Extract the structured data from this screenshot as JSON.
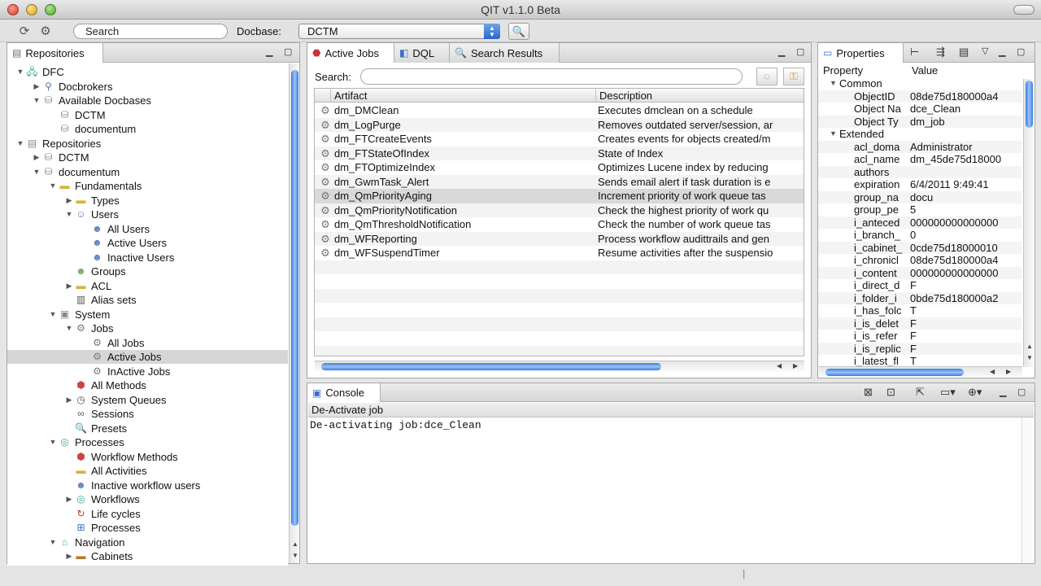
{
  "window": {
    "title": "QIT v1.1.0 Beta"
  },
  "toolbar": {
    "search_label": "Search",
    "docbase_label": "Docbase:",
    "docbase_value": "DCTM"
  },
  "repositories": {
    "tab_label": "Repositories",
    "tree": [
      {
        "label": "DFC",
        "level": 0,
        "expanded": true,
        "icon": "network-icon"
      },
      {
        "label": "Docbrokers",
        "level": 1,
        "expanded": false,
        "icon": "plug-icon"
      },
      {
        "label": "Available Docbases",
        "level": 1,
        "expanded": true,
        "icon": "database-icon"
      },
      {
        "label": "DCTM",
        "level": 2,
        "icon": "database-icon"
      },
      {
        "label": "documentum",
        "level": 2,
        "icon": "database-icon"
      },
      {
        "label": "Repositories",
        "level": 0,
        "expanded": true,
        "icon": "repositories-icon"
      },
      {
        "label": "DCTM",
        "level": 1,
        "expanded": false,
        "icon": "database-icon"
      },
      {
        "label": "documentum",
        "level": 1,
        "expanded": true,
        "icon": "database-icon"
      },
      {
        "label": "Fundamentals",
        "level": 2,
        "expanded": true,
        "icon": "folder-icon"
      },
      {
        "label": "Types",
        "level": 3,
        "expanded": false,
        "icon": "folder-icon"
      },
      {
        "label": "Users",
        "level": 3,
        "expanded": true,
        "icon": "user-icon"
      },
      {
        "label": "All Users",
        "level": 4,
        "icon": "users-icon"
      },
      {
        "label": "Active Users",
        "level": 4,
        "icon": "users-icon"
      },
      {
        "label": "Inactive Users",
        "level": 4,
        "icon": "users-icon"
      },
      {
        "label": "Groups",
        "level": 3,
        "icon": "group-icon"
      },
      {
        "label": "ACL",
        "level": 3,
        "expanded": false,
        "icon": "folder-icon"
      },
      {
        "label": "Alias sets",
        "level": 3,
        "icon": "alias-icon"
      },
      {
        "label": "System",
        "level": 2,
        "expanded": true,
        "icon": "system-icon"
      },
      {
        "label": "Jobs",
        "level": 3,
        "expanded": true,
        "icon": "gear-icon"
      },
      {
        "label": "All Jobs",
        "level": 4,
        "icon": "gear-icon"
      },
      {
        "label": "Active Jobs",
        "level": 4,
        "icon": "gear-icon",
        "selected": true
      },
      {
        "label": "InActive Jobs",
        "level": 4,
        "icon": "gear-icon"
      },
      {
        "label": "All Methods",
        "level": 3,
        "icon": "methods-icon"
      },
      {
        "label": "System Queues",
        "level": 3,
        "expanded": false,
        "icon": "queue-icon"
      },
      {
        "label": "Sessions",
        "level": 3,
        "icon": "sessions-icon"
      },
      {
        "label": "Presets",
        "level": 3,
        "icon": "magnifier-icon"
      },
      {
        "label": "Processes",
        "level": 2,
        "expanded": true,
        "icon": "process-icon"
      },
      {
        "label": "Workflow Methods",
        "level": 3,
        "icon": "methods-icon"
      },
      {
        "label": "All Activities",
        "level": 3,
        "icon": "folder-icon"
      },
      {
        "label": "Inactive workflow users",
        "level": 3,
        "icon": "users-icon"
      },
      {
        "label": "Workflows",
        "level": 3,
        "expanded": false,
        "icon": "process-icon"
      },
      {
        "label": "Life cycles",
        "level": 3,
        "icon": "lifecycle-icon"
      },
      {
        "label": "Processes",
        "level": 3,
        "icon": "diagram-icon"
      },
      {
        "label": "Navigation",
        "level": 2,
        "expanded": true,
        "icon": "house-icon"
      },
      {
        "label": "Cabinets",
        "level": 3,
        "expanded": false,
        "icon": "cabinet-icon"
      }
    ]
  },
  "jobs": {
    "tabs": [
      {
        "label": "Active Jobs",
        "icon": "jobs-icon"
      },
      {
        "label": "DQL",
        "icon": "dql-icon"
      },
      {
        "label": "Search Results",
        "icon": "magnifier-icon"
      }
    ],
    "search_label": "Search:",
    "columns": [
      "Artifact",
      "Description"
    ],
    "rows": [
      {
        "artifact": "dm_DMClean",
        "description": "Executes dmclean on a schedule"
      },
      {
        "artifact": "dm_LogPurge",
        "description": "Removes outdated server/session, ar"
      },
      {
        "artifact": "dm_FTCreateEvents",
        "description": "Creates events for objects created/m"
      },
      {
        "artifact": "dm_FTStateOfIndex",
        "description": "State of Index"
      },
      {
        "artifact": "dm_FTOptimizeIndex",
        "description": "Optimizes Lucene index by reducing"
      },
      {
        "artifact": "dm_GwmTask_Alert",
        "description": "Sends email alert if task duration is e"
      },
      {
        "artifact": "dm_QmPriorityAging",
        "description": "Increment priority of work queue tas",
        "selected": true
      },
      {
        "artifact": "dm_QmPriorityNotification",
        "description": "Check the highest priority of work qu"
      },
      {
        "artifact": "dm_QmThresholdNotification",
        "description": "Check the number of work queue tas"
      },
      {
        "artifact": "dm_WFReporting",
        "description": "Process workflow audittrails and gen"
      },
      {
        "artifact": "dm_WFSuspendTimer",
        "description": "Resume activities after the suspensio"
      }
    ]
  },
  "properties": {
    "tab_label": "Properties",
    "columns": [
      "Property",
      "Value"
    ],
    "rows": [
      {
        "group": "Common"
      },
      {
        "key": "ObjectID",
        "value": "08de75d180000a4"
      },
      {
        "key": "Object Na",
        "value": "dce_Clean"
      },
      {
        "key": "Object Ty",
        "value": "dm_job"
      },
      {
        "group": "Extended"
      },
      {
        "key": "acl_doma",
        "value": "Administrator"
      },
      {
        "key": "acl_name",
        "value": "dm_45de75d18000"
      },
      {
        "key": "authors",
        "value": ""
      },
      {
        "key": "expiration",
        "value": "6/4/2011 9:49:41"
      },
      {
        "key": "group_na",
        "value": "docu"
      },
      {
        "key": "group_pe",
        "value": "5"
      },
      {
        "key": "i_anteced",
        "value": "000000000000000"
      },
      {
        "key": "i_branch_",
        "value": "0"
      },
      {
        "key": "i_cabinet_",
        "value": "0cde75d18000010"
      },
      {
        "key": "i_chronicl",
        "value": "08de75d180000a4"
      },
      {
        "key": "i_content",
        "value": "000000000000000"
      },
      {
        "key": "i_direct_d",
        "value": "F"
      },
      {
        "key": "i_folder_i",
        "value": "0bde75d180000a2"
      },
      {
        "key": "i_has_folc",
        "value": "T"
      },
      {
        "key": "i_is_delet",
        "value": "F"
      },
      {
        "key": "i_is_refer",
        "value": "F"
      },
      {
        "key": "i_is_replic",
        "value": "F"
      },
      {
        "key": "i_latest_fl",
        "value": "T"
      }
    ]
  },
  "console": {
    "tab_label": "Console",
    "subtitle": "De-Activate job",
    "output": "De-activating job:dce_Clean"
  }
}
